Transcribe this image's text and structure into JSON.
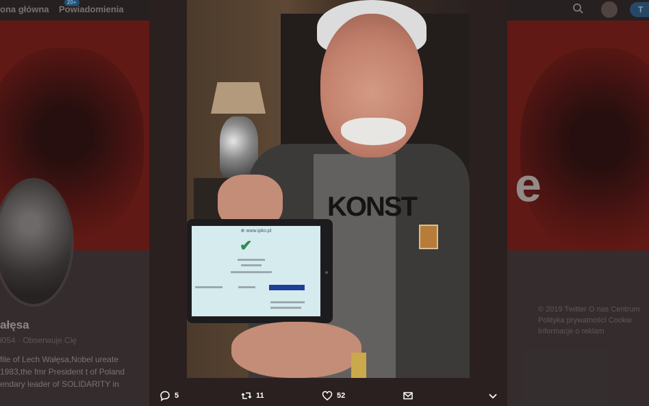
{
  "background": {
    "nav": {
      "home_label": "ona główna",
      "notifications_label": "Powiadomienia",
      "notifications_badge": "20+",
      "tweet_button": "T"
    },
    "profile": {
      "name": "ałęsa",
      "handle": "ł054 · Obserwuje Cię",
      "bio": "file of Lech Wałęsa,Nobel ureate 1983,the fmr President t of Poland endary leader of SOLIDARITY in",
      "banner_letter": "e"
    },
    "footer": "© 2019 Twitter   O nas   Centrum Polityka prywatności   Cookie Informacje o reklam"
  },
  "tablet": {
    "url": "⊕ www.ipko.pl"
  },
  "shirt_text": "KONST",
  "actions": {
    "replies": "5",
    "retweets": "11",
    "likes": "52"
  }
}
